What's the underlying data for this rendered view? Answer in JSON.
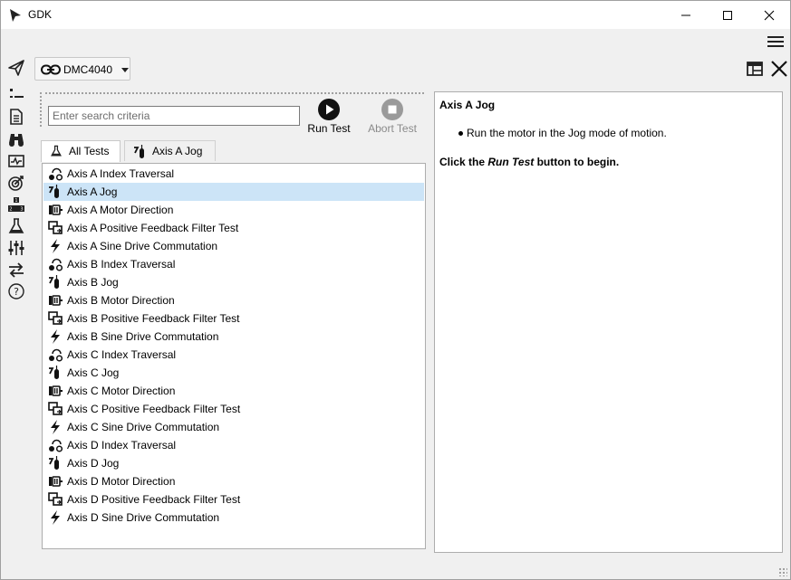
{
  "window": {
    "title": "GDK"
  },
  "controller": {
    "name": "DMC4040"
  },
  "search": {
    "placeholder": "Enter search criteria",
    "value": ""
  },
  "toolbar": {
    "run_label": "Run Test",
    "abort_label": "Abort Test"
  },
  "tabs": [
    {
      "label": "All Tests",
      "icon": "flask-icon"
    },
    {
      "label": "Axis A Jog",
      "icon": "jog-icon"
    }
  ],
  "tests": [
    {
      "label": "Axis A Index Traversal",
      "icon": "index-traversal-icon"
    },
    {
      "label": "Axis A Jog",
      "icon": "jog-icon",
      "selected": true
    },
    {
      "label": "Axis A Motor Direction",
      "icon": "motor-direction-icon"
    },
    {
      "label": "Axis A Positive Feedback Filter Test",
      "icon": "feedback-filter-icon"
    },
    {
      "label": "Axis A Sine Drive Commutation",
      "icon": "lightning-icon"
    },
    {
      "label": "Axis B Index Traversal",
      "icon": "index-traversal-icon"
    },
    {
      "label": "Axis B Jog",
      "icon": "jog-icon"
    },
    {
      "label": "Axis B Motor Direction",
      "icon": "motor-direction-icon"
    },
    {
      "label": "Axis B Positive Feedback Filter Test",
      "icon": "feedback-filter-icon"
    },
    {
      "label": "Axis B Sine Drive Commutation",
      "icon": "lightning-icon"
    },
    {
      "label": "Axis C Index Traversal",
      "icon": "index-traversal-icon"
    },
    {
      "label": "Axis C Jog",
      "icon": "jog-icon"
    },
    {
      "label": "Axis C Motor Direction",
      "icon": "motor-direction-icon"
    },
    {
      "label": "Axis C Positive Feedback Filter Test",
      "icon": "feedback-filter-icon"
    },
    {
      "label": "Axis C Sine Drive Commutation",
      "icon": "lightning-icon"
    },
    {
      "label": "Axis D Index Traversal",
      "icon": "index-traversal-icon"
    },
    {
      "label": "Axis D Jog",
      "icon": "jog-icon"
    },
    {
      "label": "Axis D Motor Direction",
      "icon": "motor-direction-icon"
    },
    {
      "label": "Axis D Positive Feedback Filter Test",
      "icon": "feedback-filter-icon"
    },
    {
      "label": "Axis D Sine Drive Commutation",
      "icon": "lightning-icon"
    }
  ],
  "details": {
    "title": "Axis A Jog",
    "bullet": "Run the motor in the Jog mode of motion.",
    "instr_prefix": "Click the ",
    "instr_emph": "Run Test",
    "instr_suffix": " button to begin."
  },
  "sidebar_icons": [
    "send-icon",
    "list-icon",
    "document-icon",
    "binoculars-icon",
    "scope-icon",
    "target-icon",
    "ranking-icon",
    "flask-icon",
    "sliders-icon",
    "transfer-icon",
    "help-icon"
  ],
  "colors": {
    "selection": "#cce4f7",
    "border": "#adadad",
    "background": "#f0f0f0"
  }
}
